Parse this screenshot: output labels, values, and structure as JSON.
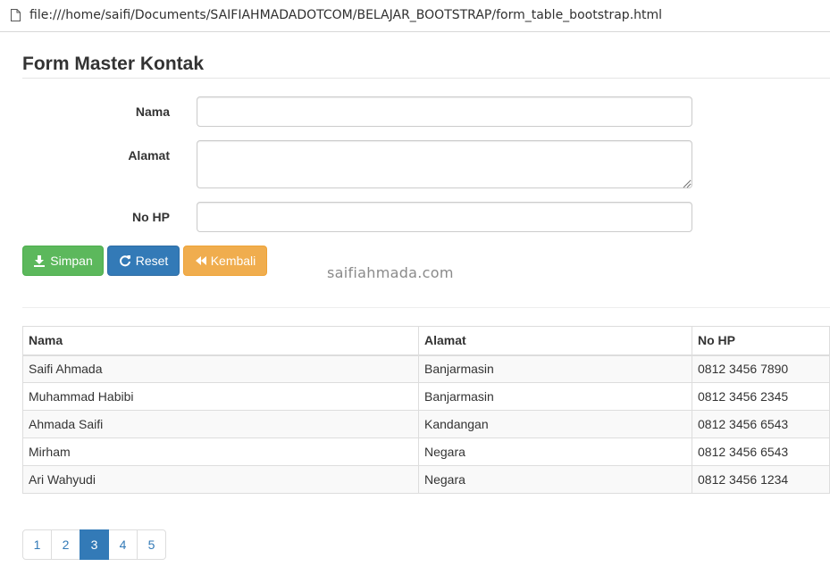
{
  "browser": {
    "url": "file:///home/saifi/Documents/SAIFIAHMADADOTCOM/BELAJAR_BOOTSTRAP/form_table_bootstrap.html",
    "page_icon": "document-icon"
  },
  "page": {
    "title": "Form Master Kontak",
    "watermark": "saifiahmada.com"
  },
  "form": {
    "fields": [
      {
        "label": "Nama",
        "value": "",
        "type": "text"
      },
      {
        "label": "Alamat",
        "value": "",
        "type": "textarea"
      },
      {
        "label": "No HP",
        "value": "",
        "type": "text"
      }
    ],
    "buttons": {
      "save": {
        "label": "Simpan",
        "icon": "download-icon",
        "color": "#5cb85c"
      },
      "reset": {
        "label": "Reset",
        "icon": "refresh-icon",
        "color": "#337ab7"
      },
      "back": {
        "label": "Kembali",
        "icon": "backward-icon",
        "color": "#f0ad4e"
      }
    }
  },
  "table": {
    "headers": [
      "Nama",
      "Alamat",
      "No HP"
    ],
    "rows": [
      [
        "Saifi Ahmada",
        "Banjarmasin",
        "0812 3456 7890"
      ],
      [
        "Muhammad Habibi",
        "Banjarmasin",
        "0812 3456 2345"
      ],
      [
        "Ahmada Saifi",
        "Kandangan",
        "0812 3456 6543"
      ],
      [
        "Mirham",
        "Negara",
        "0812 3456 6543"
      ],
      [
        "Ari Wahyudi",
        "Negara",
        "0812 3456 1234"
      ]
    ]
  },
  "pagination": {
    "pages": [
      "1",
      "2",
      "3",
      "4",
      "5"
    ],
    "active": "3",
    "accent": "#337ab7"
  }
}
